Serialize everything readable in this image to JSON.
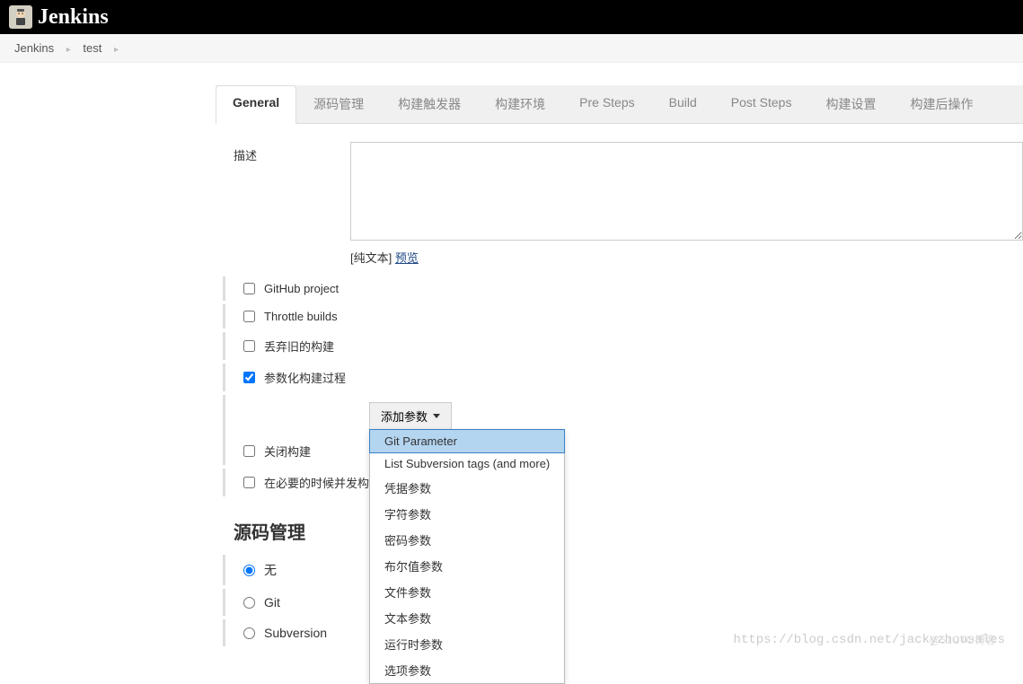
{
  "header": {
    "title": "Jenkins"
  },
  "breadcrumb": {
    "items": [
      "Jenkins",
      "test"
    ]
  },
  "tabs": {
    "items": [
      {
        "label": "General",
        "active": true
      },
      {
        "label": "源码管理",
        "active": false
      },
      {
        "label": "构建触发器",
        "active": false
      },
      {
        "label": "构建环境",
        "active": false
      },
      {
        "label": "Pre Steps",
        "active": false
      },
      {
        "label": "Build",
        "active": false
      },
      {
        "label": "Post Steps",
        "active": false
      },
      {
        "label": "构建设置",
        "active": false
      },
      {
        "label": "构建后操作",
        "active": false
      }
    ]
  },
  "form": {
    "description_label": "描述",
    "description_value": "",
    "plain_text_label": "[纯文本]",
    "preview_label": "预览"
  },
  "checkboxes": {
    "github_project": {
      "label": "GitHub project",
      "checked": false
    },
    "throttle_builds": {
      "label": "Throttle builds",
      "checked": false
    },
    "discard_old": {
      "label": "丢弃旧的构建",
      "checked": false
    },
    "parameterized": {
      "label": "参数化构建过程",
      "checked": true
    },
    "close_build": {
      "label": "关闭构建",
      "checked": false
    },
    "concurrent_build": {
      "label": "在必要的时候并发构建",
      "checked": false
    }
  },
  "add_param": {
    "button_label": "添加参数",
    "options": [
      "Git Parameter",
      "List Subversion tags (and more)",
      "凭据参数",
      "字符参数",
      "密码参数",
      "布尔值参数",
      "文件参数",
      "文本参数",
      "运行时参数",
      "选项参数"
    ],
    "highlighted_index": 0
  },
  "scm_section": {
    "title": "源码管理",
    "radios": {
      "none": {
        "label": "无",
        "checked": true
      },
      "git": {
        "label": "Git",
        "checked": false
      },
      "subversion": {
        "label": "Subversion",
        "checked": false
      }
    }
  },
  "watermark": "https://blog.csdn.net/jackyzhousales",
  "secondary_watermark": "@51CTO博客"
}
